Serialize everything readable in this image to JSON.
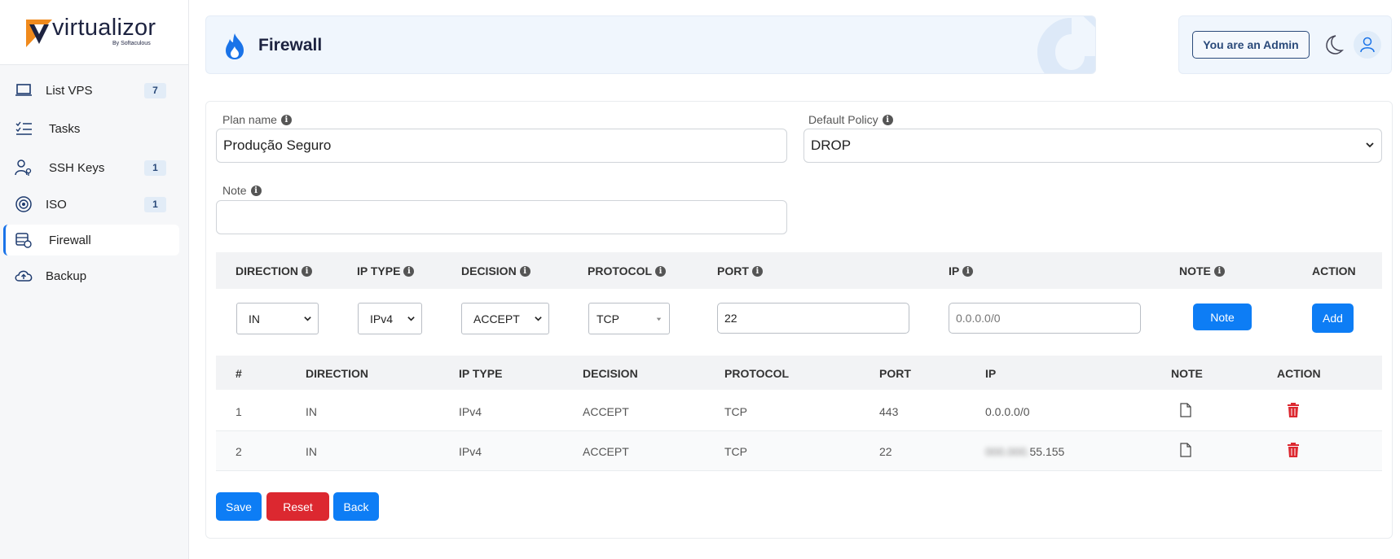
{
  "brand": {
    "name": "virtualizor",
    "sub": "By Softaculous"
  },
  "sidebar": {
    "items": [
      {
        "label": "List VPS",
        "badge": "7"
      },
      {
        "label": "Tasks",
        "badge": ""
      },
      {
        "label": "SSH Keys",
        "badge": "1"
      },
      {
        "label": "ISO",
        "badge": "1"
      },
      {
        "label": "Firewall",
        "badge": "",
        "active": true
      },
      {
        "label": "Backup",
        "badge": ""
      }
    ]
  },
  "header": {
    "title": "Firewall",
    "admin_label": "You are an Admin"
  },
  "form": {
    "plan_name_label": "Plan name",
    "plan_name_value": "Produção Seguro",
    "default_policy_label": "Default Policy",
    "default_policy_value": "DROP",
    "note_label": "Note",
    "note_value": ""
  },
  "add_rule": {
    "headers": {
      "direction": "DIRECTION",
      "ip_type": "IP TYPE",
      "decision": "DECISION",
      "protocol": "PROTOCOL",
      "port": "PORT",
      "ip": "IP",
      "note": "NOTE",
      "action": "ACTION"
    },
    "direction": "IN",
    "ip_type": "IPv4",
    "decision": "ACCEPT",
    "protocol": "TCP",
    "port": "22",
    "ip_placeholder": "0.0.0.0/0",
    "note_button": "Note",
    "add_button": "Add"
  },
  "rules_table": {
    "headers": {
      "num": "#",
      "direction": "DIRECTION",
      "ip_type": "IP TYPE",
      "decision": "DECISION",
      "protocol": "PROTOCOL",
      "port": "PORT",
      "ip": "IP",
      "note": "NOTE",
      "action": "ACTION"
    },
    "rows": [
      {
        "num": "1",
        "direction": "IN",
        "ip_type": "IPv4",
        "decision": "ACCEPT",
        "protocol": "TCP",
        "port": "443",
        "ip_hidden": "",
        "ip": "0.0.0.0/0"
      },
      {
        "num": "2",
        "direction": "IN",
        "ip_type": "IPv4",
        "decision": "ACCEPT",
        "protocol": "TCP",
        "port": "22",
        "ip_hidden": "000.000.",
        "ip": "55.155"
      }
    ]
  },
  "buttons": {
    "save": "Save",
    "reset": "Reset",
    "back": "Back"
  },
  "colors": {
    "primary": "#0d7df5",
    "danger": "#dc2830",
    "brand_navy": "#1d2340",
    "brand_orange": "#f08a1c"
  }
}
